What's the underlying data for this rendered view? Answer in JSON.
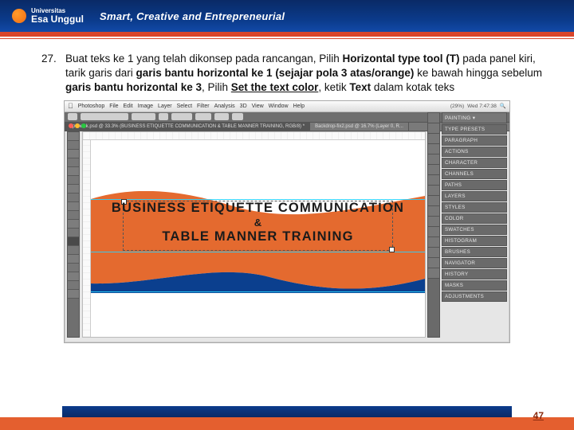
{
  "header": {
    "brand_top": "Universitas",
    "brand": "Esa Unggul",
    "tagline": "Smart, Creative and Entrepreneurial"
  },
  "instruction": {
    "number": "27.",
    "p1a": "Buat teks ke 1 yang telah dikonsep pada rancangan, Pilih ",
    "p1b": "Horizontal type tool (T)",
    "p2a": " pada panel kiri, tarik garis dari ",
    "p2b": "garis bantu horizontal ke 1 (sejajar pola 3 atas/orange)",
    "p3a": " ke bawah hingga sebelum ",
    "p3b": "garis bantu horizontal ke 3",
    "p4a": ", Pilih ",
    "p4b": "Set the text color",
    "p5a": ", ketik ",
    "p5b": "Text",
    "p5c": " dalam kotak teks"
  },
  "mac_menu": {
    "apple": "",
    "items": [
      "Photoshop",
      "File",
      "Edit",
      "Image",
      "Layer",
      "Select",
      "Filter",
      "Analysis",
      "3D",
      "View",
      "Window",
      "Help"
    ],
    "clock": "Wed 7:47:38",
    "pct": "(29%)"
  },
  "doc_tabs": [
    "Spanduk.psd @ 33.3% (BUSINESS ETIQUETTE COMMUNICATION & TABLE MANNER TRAINING, RGB/8) *",
    "Backdrop-fix2.psd @ 16.7% (Layer 0, R..."
  ],
  "panel_top": "PAINTING ▾",
  "panels": [
    "TYPE PRESETS",
    "PARAGRAPH",
    "ACTIONS",
    "CHARACTER",
    "CHANNELS",
    "PATHS",
    "LAYERS",
    "STYLES",
    "COLOR",
    "SWATCHES",
    "HISTOGRAM",
    "BRUSHES",
    "NAVIGATOR",
    "HISTORY",
    "MASKS",
    "ADJUSTMENTS"
  ],
  "banner": {
    "line1": "BUSINESS ETIQUETTE COMMUNICATION",
    "amp": "&",
    "line2": "TABLE MANNER TRAINING"
  },
  "page_number": "47"
}
